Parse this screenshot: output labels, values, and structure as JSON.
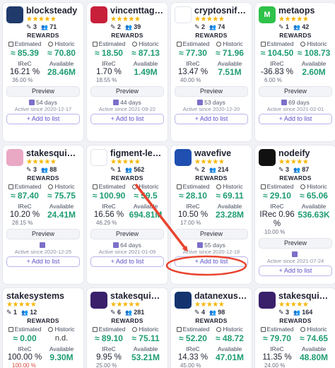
{
  "labels": {
    "rewards": "REWARDS",
    "estimated": "Estimated",
    "historic": "Historic",
    "irec": "IReC",
    "available": "Available",
    "preview": "Preview",
    "add": "+ Add to list"
  },
  "colors": {
    "star": "#f7b500",
    "positive": "#1f9d72",
    "accent": "#5f53c9",
    "annotation": "#e8432e"
  },
  "cards": [
    {
      "name": "blocksteady",
      "avatar": "#1f3a6b",
      "avatar_text": "",
      "stars": "★★★★★",
      "delegations": "3",
      "delegators": "71",
      "estimated": "≈ 85.39",
      "historic": "≈ 70.80",
      "irec": "16.21 %",
      "available": "28.46M",
      "sub": "36.00 %",
      "days": "54 days",
      "since": "Active since 2020-12-17"
    },
    {
      "name": "vincenttaglia",
      "avatar": "#c8203a",
      "avatar_text": "",
      "stars": "★★★★★",
      "delegations": "2",
      "delegators": "39",
      "estimated": "≈ 18.50",
      "historic": "≈ 87.13",
      "irec": "1.70 %",
      "available": "1.49M",
      "sub": "18.55 %",
      "days": "44 days",
      "since": "Active since 2021-09-22"
    },
    {
      "name": "cryptosniffers",
      "avatar": "#ffffff",
      "avatar_text": "",
      "stars": "★★★★★",
      "delegations": "2",
      "delegators": "74",
      "estimated": "≈ 77.30",
      "historic": "≈ 71.96",
      "irec": "13.47 %",
      "available": "7.51M",
      "sub": "40.00 %",
      "days": "53 days",
      "since": "Active since 2020-12-20"
    },
    {
      "name": "metaops",
      "avatar": "#2fc24a",
      "avatar_text": "M",
      "stars": "★★★★★",
      "delegations": "1",
      "delegators": "42",
      "estimated": "≈ 104.50",
      "historic": "≈ 108.73",
      "irec": "-36.83 %",
      "available": "2.60M",
      "sub": "6.00 %",
      "days": "69 days",
      "since": "Active since 2021-02-01"
    },
    {
      "name": "stakesquid-3",
      "avatar": "#e9a8c4",
      "avatar_text": "",
      "stars": "★★★★★",
      "delegations": "3",
      "delegators": "88",
      "estimated": "≈ 87.40",
      "historic": "≈ 75.75",
      "irec": "10.20 %",
      "available": "24.41M",
      "sub": "28.15 %",
      "days": "",
      "since": "Active since 2020-12-25"
    },
    {
      "name": "figment-lemnisc...",
      "avatar": "#ffffff",
      "avatar_text": "",
      "stars": "★★★★★",
      "delegations": "1",
      "delegators": "562",
      "estimated": "≈ 100.90",
      "historic": "≈ 59.5",
      "irec": "16.56 %",
      "available": "694.81M",
      "sub": "46.29 %",
      "days": "64 days",
      "since": "Active since 2021-01-09"
    },
    {
      "name": "wavefive",
      "avatar": "#1f4fb0",
      "avatar_text": "",
      "stars": "★★★★★",
      "delegations": "2",
      "delegators": "214",
      "estimated": "≈ 28.10",
      "historic": "≈ 69.11",
      "irec": "10.50 %",
      "available": "23.28M",
      "sub": "17.00 %",
      "days": "55 days",
      "since": "Active since 2020-12-18"
    },
    {
      "name": "nodeify",
      "avatar": "#111111",
      "avatar_text": "",
      "stars": "★★★★★",
      "delegations": "3",
      "delegators": "87",
      "estimated": "≈ 29.10",
      "historic": "≈ 65.06",
      "irec": "IRec 0.96 %",
      "available": "536.63K",
      "sub": "10.00 %",
      "days": "",
      "since": "Active since 2021-07-24"
    },
    {
      "name": "stakesystems",
      "avatar": "",
      "avatar_text": "",
      "stars": "★★★★★",
      "delegations": "1",
      "delegators": "12",
      "estimated": "≈ 0.00",
      "historic": "n.d.",
      "irec": "100.00 %",
      "available": "9.30M",
      "sub": "100.00 %"
    },
    {
      "name": "stakesquid-1",
      "avatar": "#3a1f6b",
      "avatar_text": "",
      "stars": "★★★★★",
      "delegations": "6",
      "delegators": "281",
      "estimated": "≈ 89.10",
      "historic": "≈ 75.11",
      "irec": "9.95 %",
      "available": "53.21M",
      "sub": "25.00 %"
    },
    {
      "name": "datanexus-in...",
      "avatar": "#14336e",
      "avatar_text": "",
      "stars": "★★★★★",
      "delegations": "4",
      "delegators": "98",
      "estimated": "≈ 52.20",
      "historic": "≈ 48.72",
      "irec": "14.33 %",
      "available": "47.01M",
      "sub": "45.00 %"
    },
    {
      "name": "stakesquid-1",
      "avatar": "#3a1f6b",
      "avatar_text": "",
      "stars": "★★★★★",
      "delegations": "3",
      "delegators": "164",
      "estimated": "≈ 79.70",
      "historic": "≈ 74.65",
      "irec": "11.35 %",
      "available": "48.80M",
      "sub": "24.00 %"
    }
  ]
}
